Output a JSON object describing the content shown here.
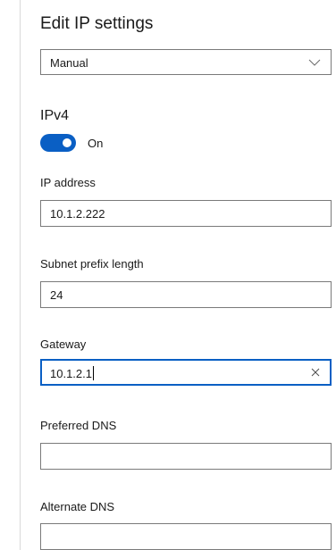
{
  "title": "Edit IP settings",
  "mode_select": {
    "selected": "Manual",
    "chevron_icon": "chevron-down-icon"
  },
  "ipv4": {
    "title": "IPv4",
    "toggle_state": "On",
    "toggle_color": "#0a5fc4"
  },
  "fields": {
    "ip_address": {
      "label": "IP address",
      "value": "10.1.2.222"
    },
    "subnet_prefix_length": {
      "label": "Subnet prefix length",
      "value": "24"
    },
    "gateway": {
      "label": "Gateway",
      "value": "10.1.2.1",
      "clear_icon": "close-icon"
    },
    "preferred_dns": {
      "label": "Preferred DNS",
      "value": ""
    },
    "alternate_dns": {
      "label": "Alternate DNS",
      "value": ""
    }
  },
  "colors": {
    "accent": "#0a5fc4",
    "border": "#7a7a7a"
  }
}
